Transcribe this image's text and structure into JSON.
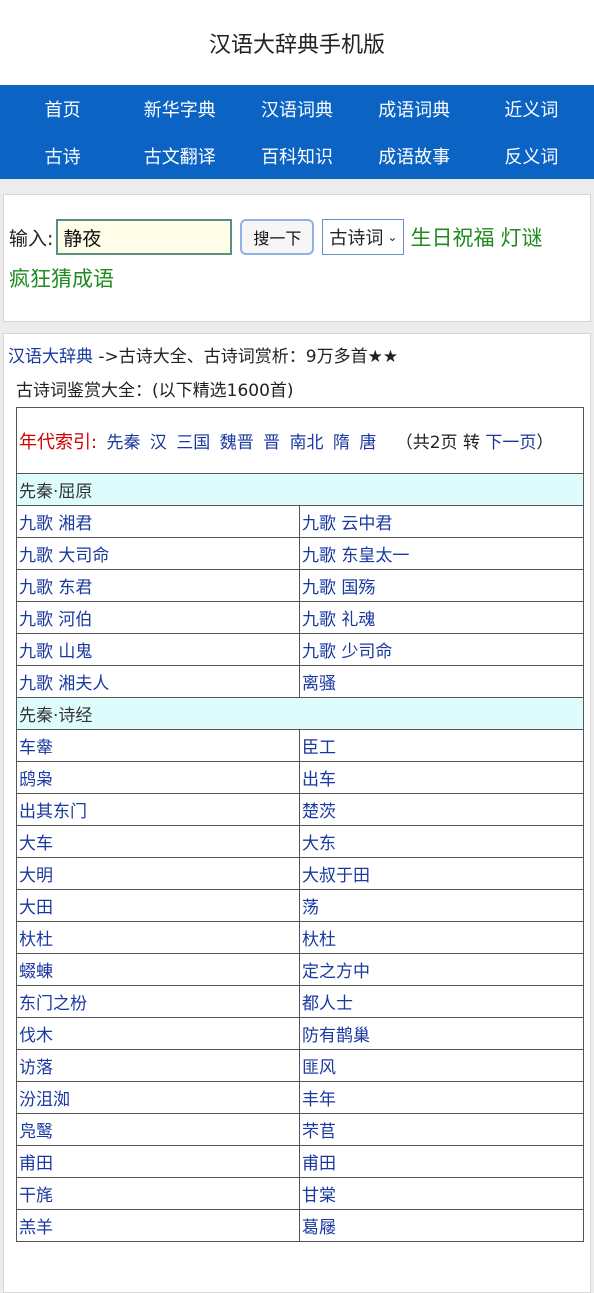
{
  "header": {
    "title": "汉语大辞典手机版"
  },
  "nav": {
    "items": [
      {
        "label": "首页"
      },
      {
        "label": "新华字典"
      },
      {
        "label": "汉语词典"
      },
      {
        "label": "成语词典"
      },
      {
        "label": "近义词"
      },
      {
        "label": "古诗"
      },
      {
        "label": "古文翻译"
      },
      {
        "label": "百科知识"
      },
      {
        "label": "成语故事"
      },
      {
        "label": "反义词"
      }
    ]
  },
  "search": {
    "label": "输入:",
    "value": "静夜",
    "button": "搜一下",
    "select_value": "古诗词",
    "links": [
      "生日祝福",
      "灯谜",
      "疯狂猜成语"
    ]
  },
  "breadcrumb": {
    "site": "汉语大辞典",
    "rest": " ->古诗大全、古诗词赏析：9万多首★★"
  },
  "subtitle": "古诗词鉴赏大全：(以下精选1600首)",
  "index": {
    "label": "年代索引:",
    "eras": [
      "先秦",
      "汉",
      "三国",
      "魏晋",
      "晋",
      "南北",
      "隋",
      "唐"
    ],
    "note": "（共2页 转",
    "next": "下一页",
    "close": "）"
  },
  "sections": [
    {
      "heading": "先秦·屈原",
      "rows": [
        [
          "九歌 湘君",
          "九歌 云中君"
        ],
        [
          "九歌 大司命",
          "九歌 东皇太一"
        ],
        [
          "九歌 东君",
          "九歌 国殇"
        ],
        [
          "九歌 河伯",
          "九歌 礼魂"
        ],
        [
          "九歌 山鬼",
          "九歌 少司命"
        ],
        [
          "九歌 湘夫人",
          "离骚"
        ]
      ]
    },
    {
      "heading": "先秦·诗经",
      "rows": [
        [
          "车舝",
          "臣工"
        ],
        [
          "鸱枭",
          "出车"
        ],
        [
          "出其东门",
          "楚茨"
        ],
        [
          "大车",
          "大东"
        ],
        [
          "大明",
          "大叔于田"
        ],
        [
          "大田",
          "荡"
        ],
        [
          "杕杜",
          "杕杜"
        ],
        [
          "蝃蝀",
          "定之方中"
        ],
        [
          "东门之枌",
          "都人士"
        ],
        [
          "伐木",
          "防有鹊巢"
        ],
        [
          "访落",
          "匪风"
        ],
        [
          "汾沮洳",
          "丰年"
        ],
        [
          "凫鹥",
          "芣苢"
        ],
        [
          "甫田",
          "甫田"
        ],
        [
          "干旄",
          "甘棠"
        ],
        [
          "羔羊",
          "葛屦"
        ]
      ]
    }
  ]
}
